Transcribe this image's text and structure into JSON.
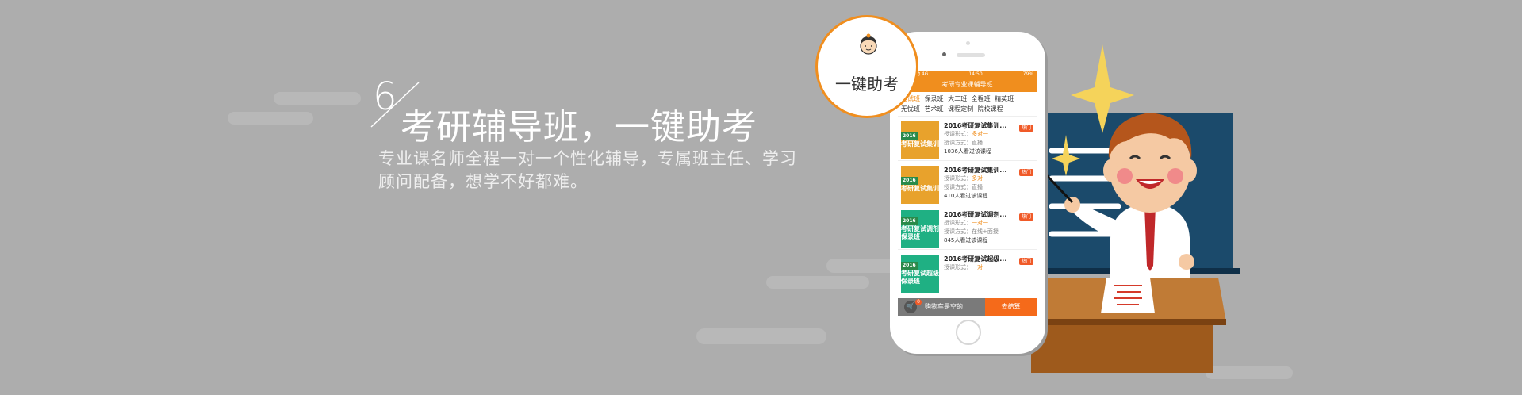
{
  "banner": {
    "number": "6",
    "title": "考研辅导班，一键助考",
    "description_lines": [
      "专业课名师全程一对一个性化辅导，专属班主任、学习",
      "顾问配备，想学不好都难。"
    ]
  },
  "badge": {
    "label": "一键助考"
  },
  "phone": {
    "status": {
      "carrier": "中国移动 4G",
      "time": "14:50",
      "battery": "79%"
    },
    "nav_title": "考研专业课辅导班",
    "tabs_row1": [
      "复试班",
      "保录班",
      "大二班",
      "全程班",
      "精英班"
    ],
    "tabs_row2": [
      "无忧班",
      "艺术班",
      "课程定制",
      "院校课程"
    ],
    "courses": [
      {
        "title": "2016考研复试集训...",
        "form": "授课形式：",
        "form_value": "多对一",
        "mode": "授课方式：直播",
        "count": "1036人看过该课程",
        "tag": "热门",
        "thumb_year": "2016",
        "thumb_text": "考研复试集训"
      },
      {
        "title": "2016考研复试集训...",
        "form": "授课形式：",
        "form_value": "多对一",
        "mode": "授课方式：直播",
        "count": "410人看过该课程",
        "tag": "热门",
        "thumb_year": "2016",
        "thumb_text": "考研复试集训"
      },
      {
        "title": "2016考研复试调剂...",
        "form": "授课形式：",
        "form_value": "一对一",
        "mode": "授课方式：在线+面授",
        "count": "845人看过该课程",
        "tag": "热门",
        "thumb_year": "2016",
        "thumb_text": "考研复试调剂保录班"
      },
      {
        "title": "2016考研复试超级...",
        "form": "授课形式：",
        "form_value": "一对一",
        "mode": "",
        "count": "",
        "tag": "热门",
        "thumb_year": "2016",
        "thumb_text": "考研复试超级保录班"
      }
    ],
    "cart": {
      "label": "购物车是空的",
      "count": "0",
      "checkout": "去结算"
    }
  },
  "colors": {
    "accent": "#f08e1e",
    "background": "#adadad",
    "checkout": "#f56a1a"
  }
}
